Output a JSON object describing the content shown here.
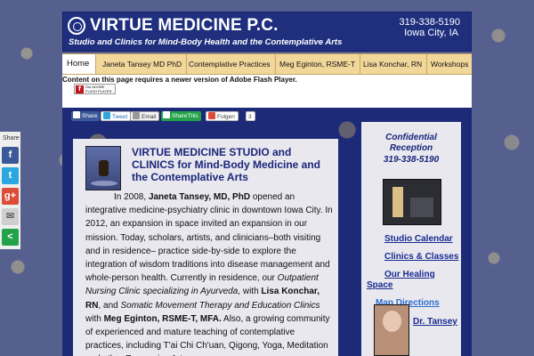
{
  "header": {
    "title": "VIRTUE MEDICINE P.C.",
    "tagline": "Studio and Clinics for Mind-Body Health and the Contemplative Arts",
    "phone": "319-338-5190",
    "city": "Iowa City, IA"
  },
  "nav": {
    "items": [
      {
        "label": "Home"
      },
      {
        "label": "Janeta Tansey MD PhD"
      },
      {
        "label": "Contemplative Practices"
      },
      {
        "label": "Meg Eginton, RSME-T"
      },
      {
        "label": "Lisa Konchar, RN"
      },
      {
        "label": "Workshops"
      }
    ]
  },
  "flash": {
    "message": "Content on this page requires a newer version of Adobe Flash Player.",
    "badge_text": "Get ADOBE FLASH PLAYER"
  },
  "share_buttons": {
    "share": "Share",
    "tweet": "Tweet",
    "email": "Email",
    "sharethis": "ShareThis",
    "follow": "Folgen",
    "follow_count": "3"
  },
  "main": {
    "title": "VIRTUE MEDICINE STUDIO and CLINICS for Mind-Body Medicine and the Contemplative Arts",
    "p_in": "In 2008,",
    "p_name1": "Janeta Tansey, MD, PhD",
    "p_text1": "opened an integrative medicine-psychiatry clinic in downtown Iowa City. In 2012, an expansion in space invited an expansion in our mission. Today, scholars, artists, and clinicians–both visiting and in residence– practice side-by-side to explore the integration of wisdom traditions into disease management and whole-person health. Currently in residence, our",
    "p_clinic1": "Outpatient Nursing Clinic specializing in Ayurveda",
    "p_with1": ", with",
    "p_name2": "Lisa Konchar, RN",
    "p_and": ", and",
    "p_clinic2": "Somatic Movement Therapy and Education Clinics",
    "p_with2": "with",
    "p_name3": "Meg Eginton, RSME-T, MFA.",
    "p_text2": "Also, a growing community of experienced and mature teaching of contemplative practices, including T'ai Chi Ch'uan, Qigong, Yoga, Meditation and other Expressive Arts."
  },
  "sidebar": {
    "heading": "Confidential Reception",
    "phone": "319-338-5190",
    "links": {
      "calendar": "Studio Calendar",
      "clinics": "Clinics & Classes",
      "healing": "Our Healing",
      "space": "Space",
      "directions": "Map Directions",
      "drtansey": "Dr. Tansey"
    }
  },
  "share_bar": {
    "label": "Share",
    "buttons": [
      {
        "name": "facebook",
        "glyph": "f",
        "color": "#3b5998"
      },
      {
        "name": "twitter",
        "glyph": "t",
        "color": "#2ca7e0"
      },
      {
        "name": "google-plus",
        "glyph": "g+",
        "color": "#dd4b39"
      },
      {
        "name": "email",
        "glyph": "✉",
        "color": "#cfcfcf"
      },
      {
        "name": "sharethis",
        "glyph": "<",
        "color": "#22a24a"
      }
    ]
  }
}
